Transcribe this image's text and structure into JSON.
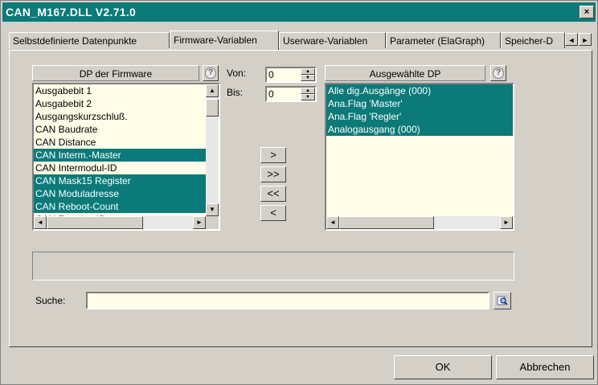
{
  "window": {
    "title": "CAN_M167.DLL V2.71.0",
    "close_label": "×"
  },
  "tabs": [
    {
      "label": "Selbstdefinierte Datenpunkte"
    },
    {
      "label": "Firmware-Variablen"
    },
    {
      "label": "Userware-Variablen"
    },
    {
      "label": "Parameter (ElaGraph)"
    },
    {
      "label": "Speicher-D"
    }
  ],
  "tab_scroll": {
    "left": "◄",
    "right": "►"
  },
  "left_list": {
    "header": "DP der Firmware",
    "help_label": "?",
    "items": [
      {
        "label": "Ausgabebit 1",
        "selected": false
      },
      {
        "label": "Ausgabebit 2",
        "selected": false
      },
      {
        "label": "Ausgangskurzschluß.",
        "selected": false
      },
      {
        "label": "CAN Baudrate",
        "selected": false
      },
      {
        "label": "CAN Distance",
        "selected": false
      },
      {
        "label": "CAN Interm.-Master",
        "selected": true
      },
      {
        "label": "CAN Intermodul-ID",
        "selected": false
      },
      {
        "label": "CAN Mask15 Register",
        "selected": true
      },
      {
        "label": "CAN Moduladresse",
        "selected": true
      },
      {
        "label": "CAN Reboot-Count",
        "selected": true
      },
      {
        "label": "CAN Receive-ID",
        "selected": false
      }
    ]
  },
  "range": {
    "from_label": "Von:",
    "from_value": "0",
    "to_label": "Bis:",
    "to_value": "0"
  },
  "move_buttons": {
    "add": ">",
    "add_all": ">>",
    "remove_all": "<<",
    "remove": "<"
  },
  "right_list": {
    "header": "Ausgewählte DP",
    "help_label": "?",
    "items": [
      {
        "label": "Alle dig.Ausgänge   (000)",
        "selected": true
      },
      {
        "label": "Ana.Flag 'Master'",
        "selected": true
      },
      {
        "label": "Ana.Flag 'Regler'",
        "selected": true
      },
      {
        "label": "Analogausgang      (000)",
        "selected": true
      }
    ]
  },
  "search": {
    "label": "Suche:",
    "value": ""
  },
  "footer": {
    "ok_label": "OK",
    "cancel_label": "Abbrechen"
  },
  "colors": {
    "title_bar": "#0b7a78",
    "selection": "#0b7a78",
    "list_background": "#fffde8",
    "dialog_background": "#d4d0c8"
  }
}
